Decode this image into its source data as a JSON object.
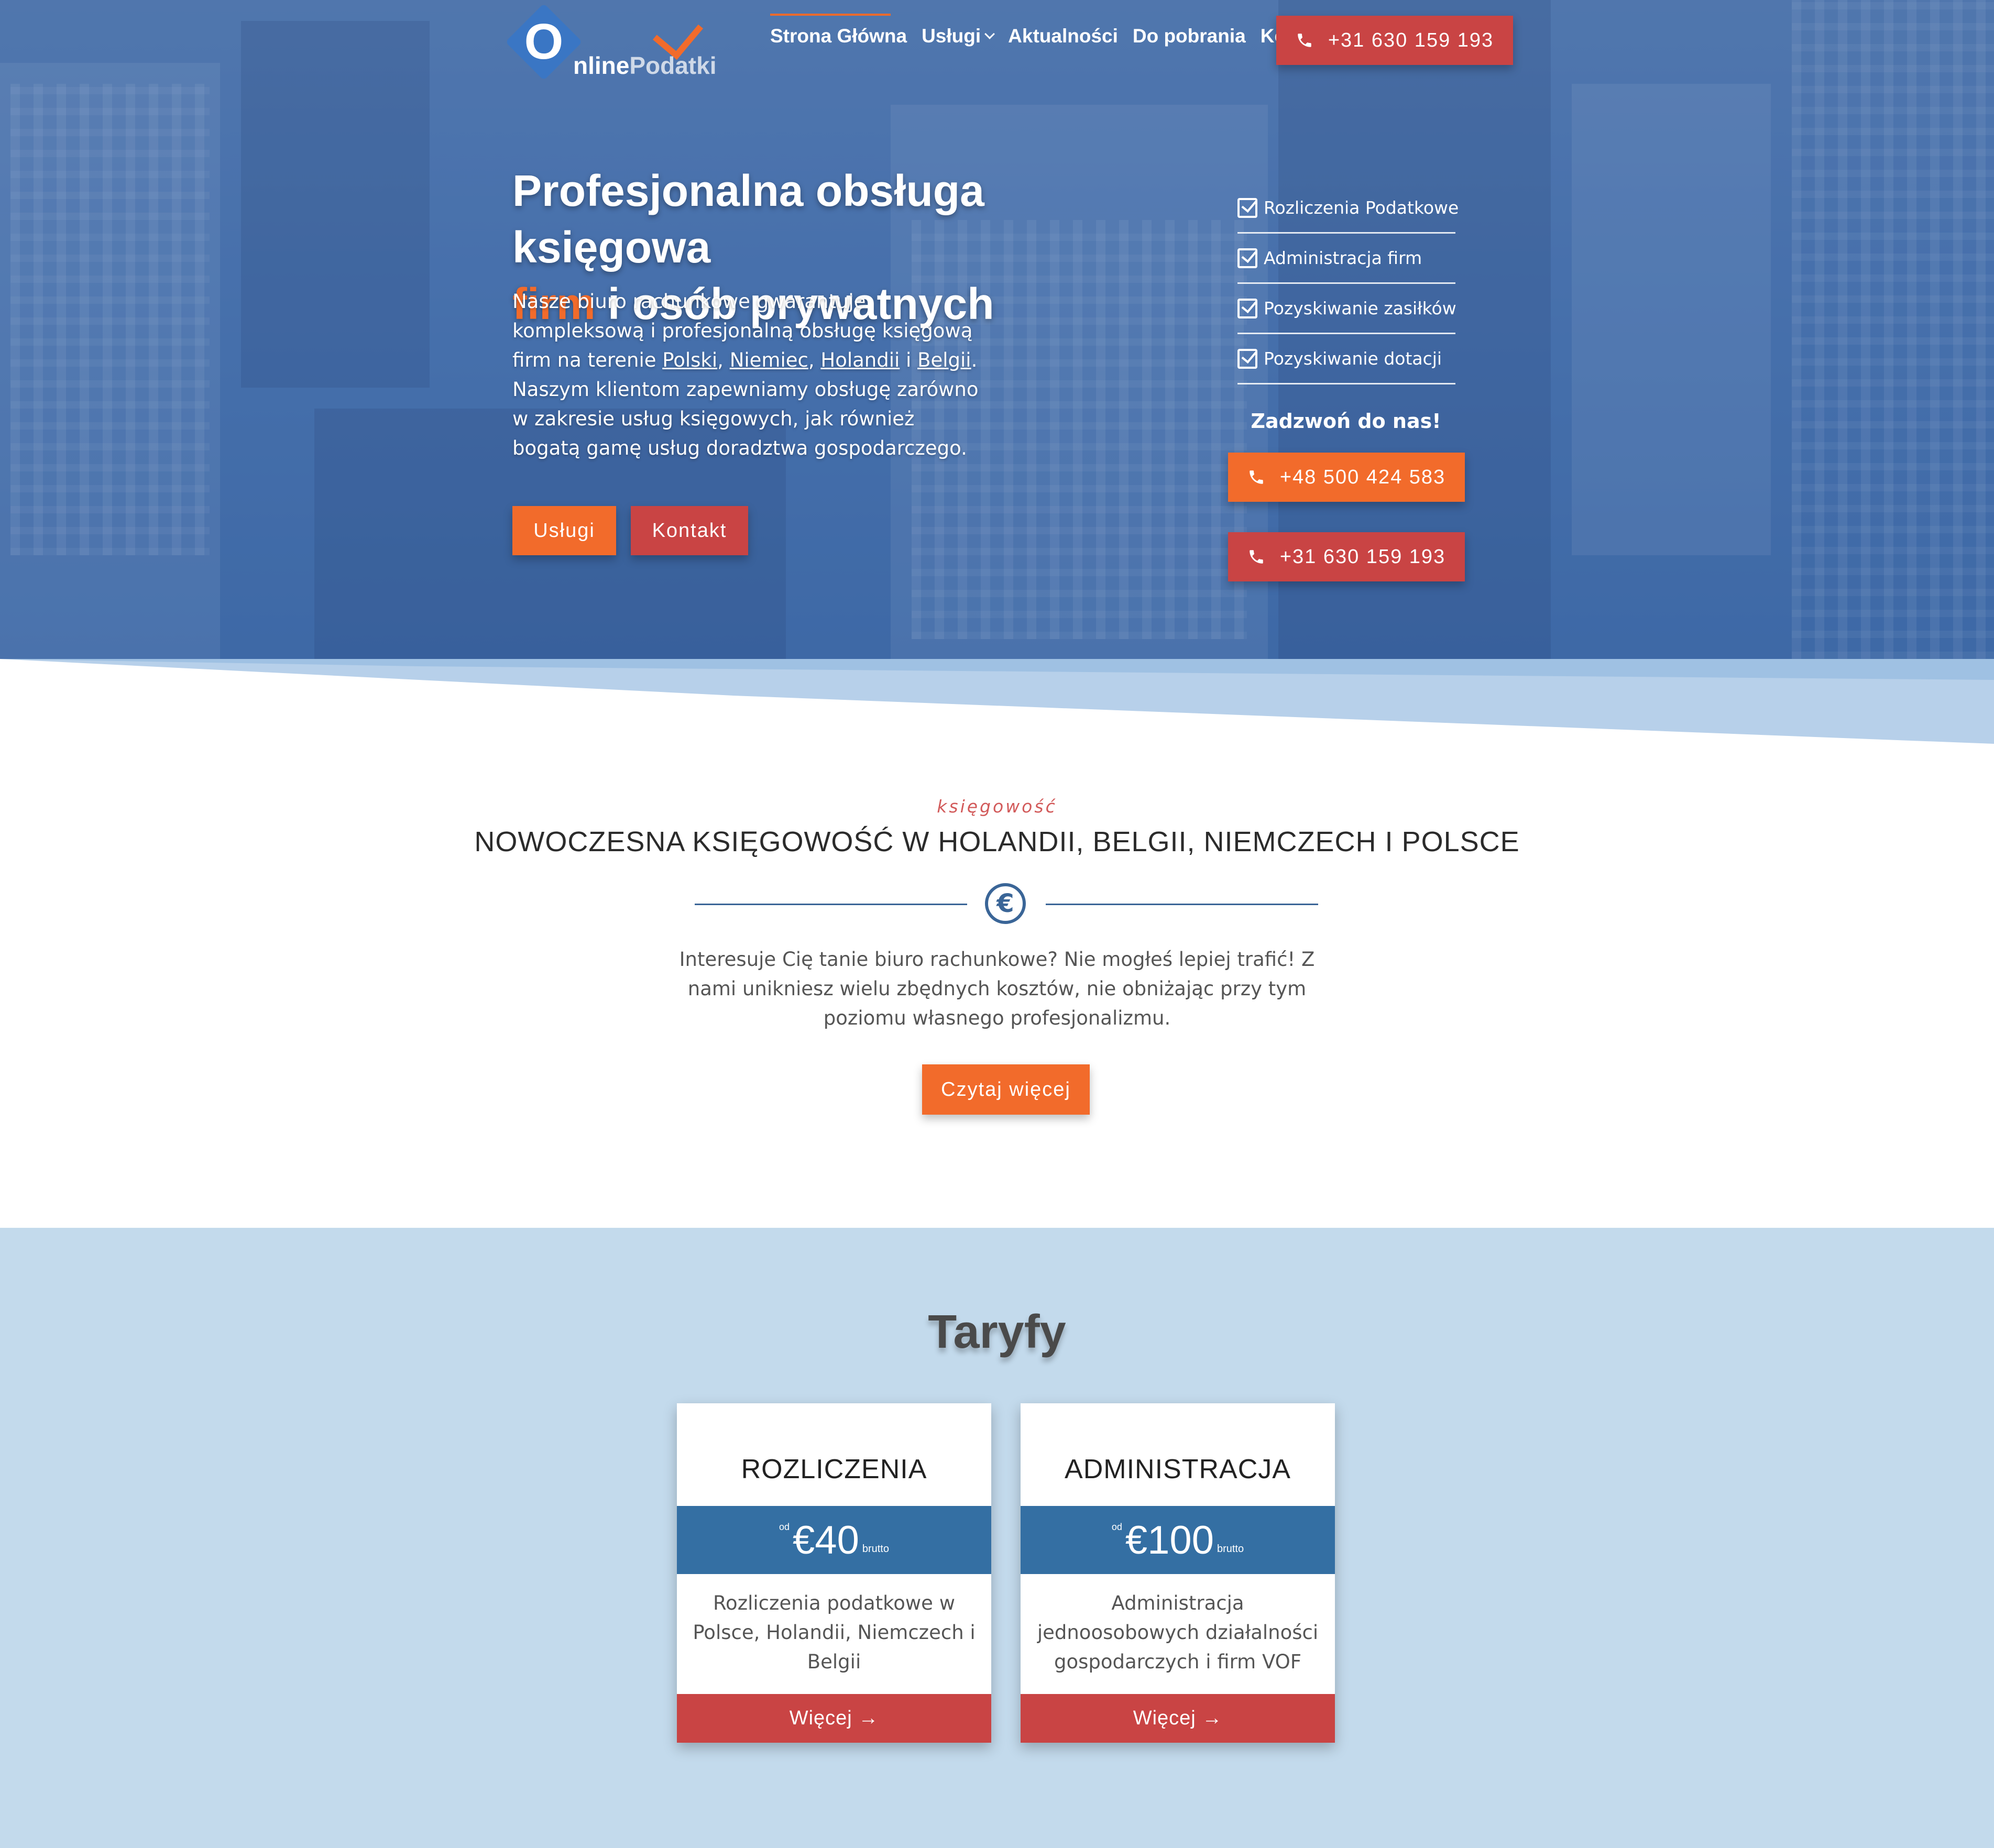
{
  "brand": {
    "logo_letter": "O",
    "name_part1": "nline",
    "name_part2": "Podatki"
  },
  "nav": {
    "items": [
      "Strona Główna",
      "Usługi",
      "Aktualności",
      "Do pobrania",
      "Kontakt"
    ],
    "phone_button": "+31 630 159 193"
  },
  "hero": {
    "title_line1": "Profesjonalna obsługa księgowa",
    "title_highlight": "firm",
    "title_line2_rest": " i osób prywatnych",
    "para_prefix": "Nasze biuro rachunkowe gwarantuje kompleksową i profesjonalną obsługę księgową firm na terenie ",
    "link_polski": "Polski",
    "link_niemiec": "Niemiec",
    "link_holandii": "Holandii",
    "link_belgii": "Belgii",
    "sep_comma": ", ",
    "sep_and": " i ",
    "para_suffix": ". Naszym klientom zapewniamy obsługę zarówno w zakresie usług księgowych, jak również bogatą gamę usług doradztwa gospodarczego.",
    "btn_uslugi": "Usługi",
    "btn_kontakt": "Kontakt",
    "checklist": [
      "Rozliczenia Podatkowe",
      "Administracja firm",
      "Pozyskiwanie zasiłków",
      "Pozyskiwanie dotacji"
    ],
    "call_heading": "Zadzwoń do nas!",
    "phone_pl": "+48 500 424 583",
    "phone_nl": "+31 630 159 193"
  },
  "intro": {
    "eyebrow": "księgowość",
    "title": "NOWOCZESNA KSIĘGOWOŚĆ W HOLANDII, BELGII, NIEMCZECH I POLSCE",
    "euro_symbol": "€",
    "text": "Interesuje Cię tanie biuro rachunkowe? Nie mogłeś lepiej trafić! Z nami unikniesz wielu zbędnych kosztów, nie obniżając przy tym poziomu własnego profesjonalizmu.",
    "button": "Czytaj więcej"
  },
  "pricing": {
    "title": "Taryfy",
    "cards": [
      {
        "name": "ROZLICZENIA",
        "prefix": "od",
        "price": "€40",
        "suffix": "brutto",
        "desc": "Rozliczenia podatkowe w Polsce, Holandii, Niemczech i Belgii",
        "button": "Więcej →"
      },
      {
        "name": "ADMINISTRACJA",
        "prefix": "od",
        "price": "€100",
        "suffix": "brutto",
        "desc": "Administracja jednoosobowych działalności gospodarczych i firm VOF",
        "button": "Więcej →"
      }
    ]
  },
  "colors": {
    "orange": "#f26b2b",
    "red": "#c94444",
    "blue": "#346fa3",
    "light_blue": "#c3daec"
  },
  "icons": [
    "phone-icon",
    "checkbox-icon",
    "chevron-down-icon",
    "euro-icon",
    "arrow-right-icon"
  ]
}
